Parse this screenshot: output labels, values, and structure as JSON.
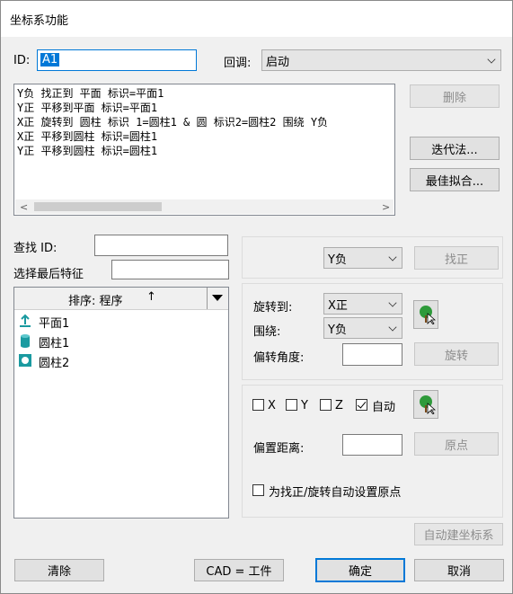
{
  "window": {
    "title": "坐标系功能"
  },
  "id_field": {
    "label": "ID:",
    "value": "A1"
  },
  "callback": {
    "label": "回调:",
    "value": "启动"
  },
  "commands": [
    "Y负 找正到 平面 标识=平面1",
    "Y正 平移到平面 标识=平面1",
    "X正 旋转到 圆柱 标识 1=圆柱1 & 圆 标识2=圆柱2 围绕 Y负",
    "X正 平移到圆柱 标识=圆柱1",
    "Y正 平移到圆柱 标识=圆柱1"
  ],
  "buttons": {
    "delete": "删除",
    "iterative": "迭代法...",
    "best_fit": "最佳拟合...",
    "level": "找正",
    "rotate": "旋转",
    "origin": "原点",
    "auto_create": "自动建坐标系",
    "clear": "清除",
    "cad_equals_part": "CAD = 工件",
    "ok": "确定",
    "cancel": "取消"
  },
  "find": {
    "label": "查找 ID:",
    "value": ""
  },
  "select_last": {
    "label": "选择最后特征",
    "value": ""
  },
  "sort": {
    "label": "排序: 程序",
    "arrow": "↑"
  },
  "features": [
    {
      "name": "平面1",
      "icon": "plane-icon"
    },
    {
      "name": "圆柱1",
      "icon": "cylinder-icon"
    },
    {
      "name": "圆柱2",
      "icon": "circle-icon"
    }
  ],
  "level_axis": "Y负",
  "rotate_to": {
    "label": "旋转到:",
    "value": "X正"
  },
  "around": {
    "label": "围绕:",
    "value": "Y负"
  },
  "offset_angle": {
    "label": "偏转角度:",
    "value": ""
  },
  "axes": {
    "x": "X",
    "y": "Y",
    "z": "Z",
    "auto": "自动",
    "x_checked": false,
    "y_checked": false,
    "z_checked": false,
    "auto_checked": true
  },
  "offset_distance": {
    "label": "偏置距离:",
    "value": ""
  },
  "auto_origin": {
    "label": "为找正/旋转自动设置原点",
    "checked": false
  }
}
